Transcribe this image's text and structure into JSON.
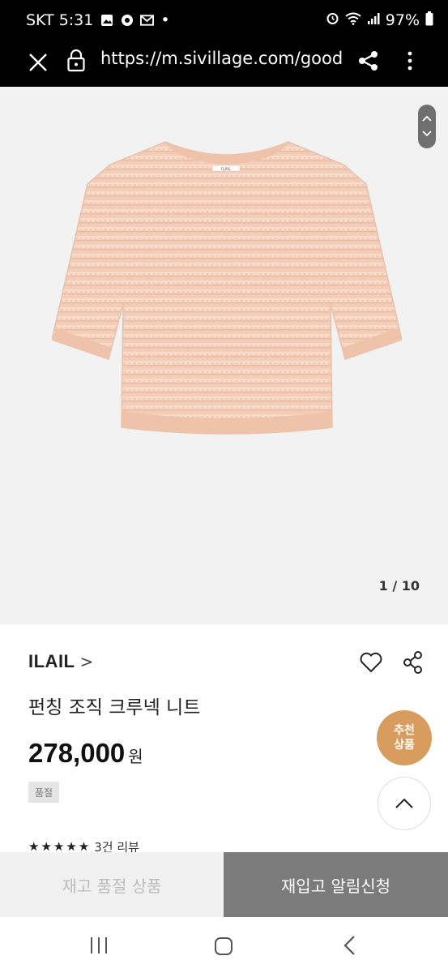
{
  "status_bar": {
    "carrier_time": "SKT 5:31",
    "battery": "97%",
    "dot": "•"
  },
  "url_bar": {
    "url": "https://m.sivillage.com/good"
  },
  "gallery": {
    "counter": "1 / 10",
    "tag_text": "ILAIL"
  },
  "product": {
    "brand": "ILAIL",
    "brand_chevron": ">",
    "name": "펀칭 조직 크루넥 니트",
    "price": "278,000",
    "price_unit": "원",
    "soldout_badge": "품절",
    "stars": "★★★★★",
    "review_count": "3건 리뷰"
  },
  "floating": {
    "recommend_line1": "추천",
    "recommend_line2": "상품"
  },
  "actions": {
    "soldout_label": "재고 품절 상품",
    "restock_label": "재입고 알림신청"
  },
  "colors": {
    "accent_orange": "#d89c5f",
    "restock_gray": "#7b7b7b",
    "garment": "#f3cdb7"
  }
}
